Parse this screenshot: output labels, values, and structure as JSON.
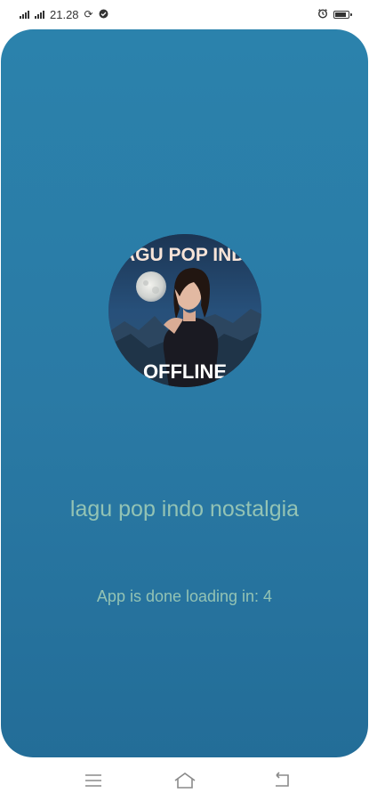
{
  "status_bar": {
    "time": "21.28",
    "icons": [
      "signal-icon",
      "signal-icon",
      "sync-icon",
      "check-badge-icon",
      "alarm-icon",
      "battery-icon"
    ]
  },
  "splash": {
    "background_color": "#2a7aa5",
    "text_color": "#93c3b4",
    "logo": {
      "top_text": "LAGU POP INDO",
      "bottom_text": "OFFLINE"
    },
    "app_title": "lagu pop indo nostalgia",
    "loading_text": "App is done loading in: 4"
  },
  "nav_bar": {
    "buttons": [
      "menu-icon",
      "home-icon",
      "back-icon"
    ]
  }
}
